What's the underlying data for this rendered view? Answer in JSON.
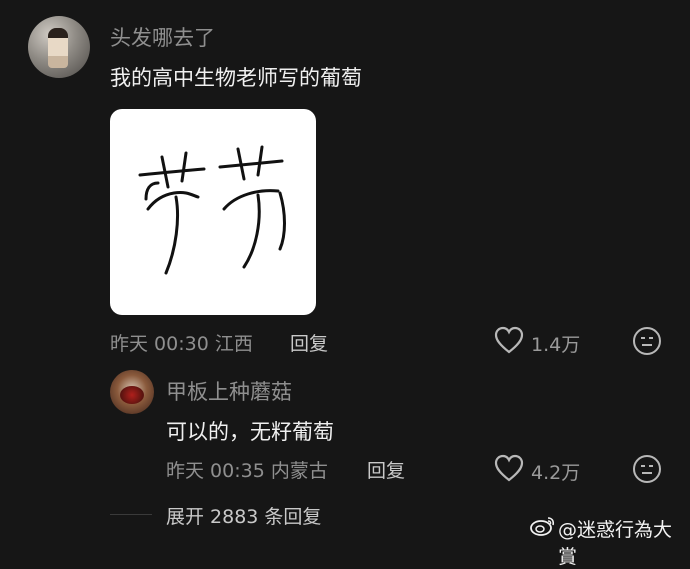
{
  "main_comment": {
    "username": "头发哪去了",
    "text": "我的高中生物老师写的葡萄",
    "time": "昨天 00:30",
    "location": "江西",
    "reply_label": "回复",
    "likes": "1.4万"
  },
  "reply_comment": {
    "username": "甲板上种蘑菇",
    "text": "可以的，无籽葡萄",
    "time": "昨天 00:35",
    "location": "内蒙古",
    "reply_label": "回复",
    "likes": "4.2万"
  },
  "expand": {
    "label": "展开 2883 条回复"
  },
  "watermark": {
    "text": "@迷惑行為大賞"
  },
  "icons": {
    "like": "heart-icon",
    "dislike": "meh-face-icon",
    "watermark": "weibo-icon"
  },
  "colors": {
    "background": "#161616",
    "muted_text": "#8f8f8f",
    "primary_text": "#f0f0f0"
  }
}
